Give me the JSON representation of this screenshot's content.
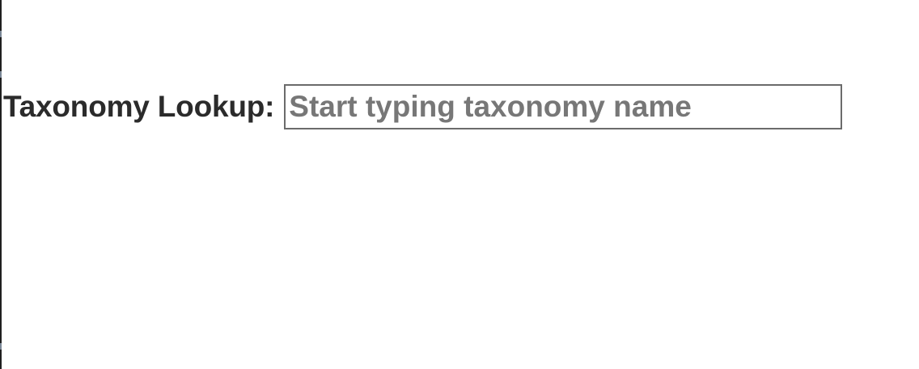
{
  "taxonomy_lookup": {
    "label": "Taxonomy Lookup:",
    "input": {
      "value": "",
      "placeholder": "Start typing taxonomy name"
    }
  }
}
